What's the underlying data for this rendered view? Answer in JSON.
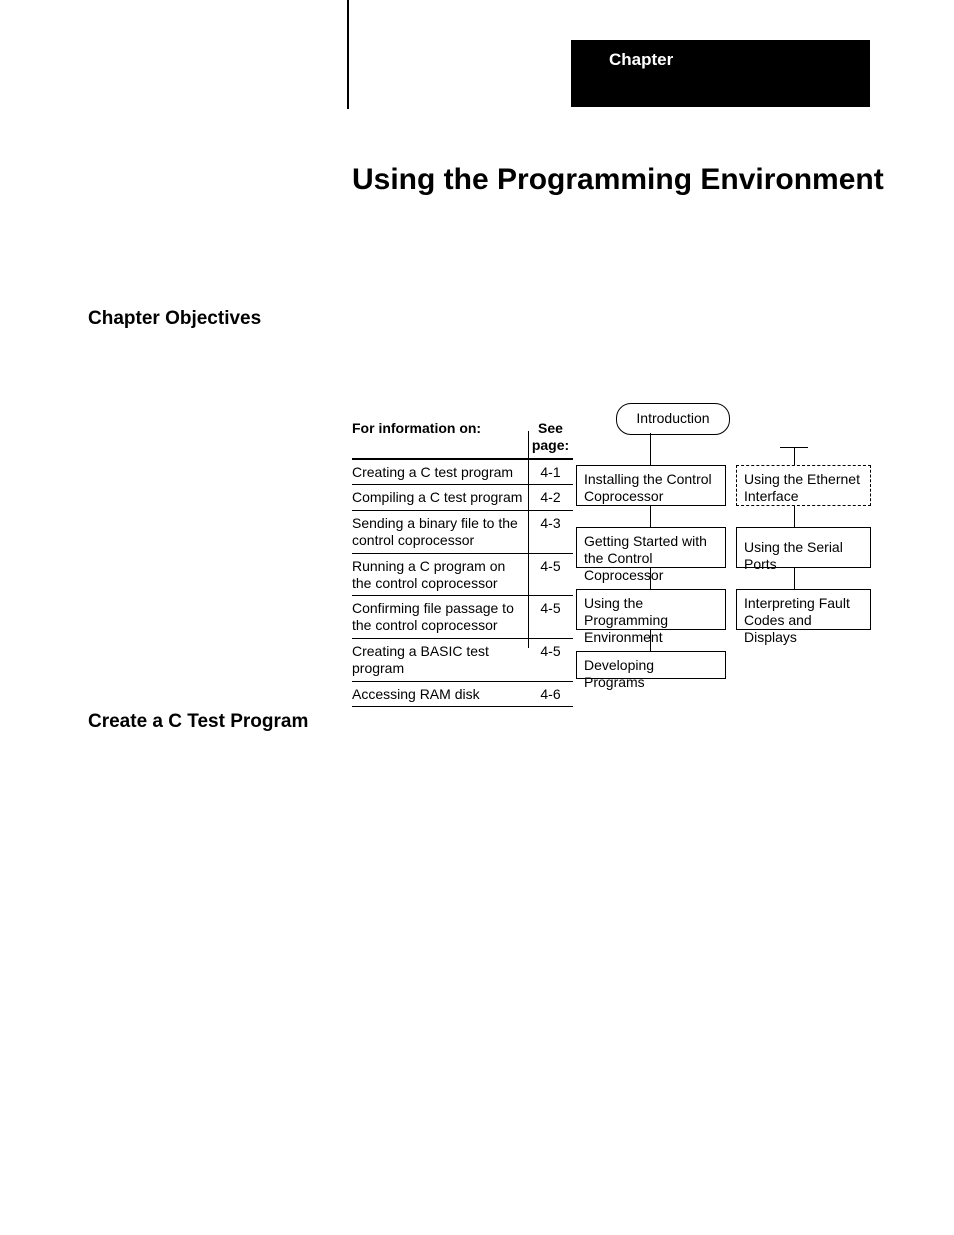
{
  "chapter_label": "Chapter",
  "title": "Using the Programming Environment",
  "section_objectives": "Chapter Objectives",
  "section_create": "Create a C Test Program",
  "table": {
    "head_col1": "For information on:",
    "head_col2": "See page:",
    "rows": [
      {
        "topic": "Creating a C test program",
        "page": "4-1"
      },
      {
        "topic": "Compiling a C test program",
        "page": "4-2"
      },
      {
        "topic": "Sending a binary file to the control coprocessor",
        "page": "4-3"
      },
      {
        "topic": "Running a C program on the control coprocessor",
        "page": "4-5"
      },
      {
        "topic": "Confirming file passage to the control coprocessor",
        "page": "4-5"
      },
      {
        "topic": "Creating a BASIC test program",
        "page": "4-5"
      },
      {
        "topic": "Accessing RAM disk",
        "page": "4-6"
      }
    ]
  },
  "chart_data": {
    "type": "flow-diagram",
    "nodes": [
      {
        "id": "intro",
        "label": "Introduction",
        "shape": "rounded"
      },
      {
        "id": "install",
        "label": "Installing the Control Coprocessor"
      },
      {
        "id": "getting",
        "label": "Getting Started with the Control Coprocessor"
      },
      {
        "id": "using",
        "label": "Using the Programming Environment"
      },
      {
        "id": "develop",
        "label": "Developing Programs"
      },
      {
        "id": "ethernet",
        "label": "Using the Ethernet Interface",
        "dashed": true
      },
      {
        "id": "serial",
        "label": "Using the Serial Ports"
      },
      {
        "id": "fault",
        "label": "Interpreting Fault Codes and Displays"
      }
    ],
    "edges": [
      [
        "intro",
        "install"
      ],
      [
        "install",
        "getting"
      ],
      [
        "getting",
        "using"
      ],
      [
        "using",
        "develop"
      ],
      [
        "ethernet",
        "serial"
      ],
      [
        "serial",
        "fault"
      ]
    ]
  }
}
